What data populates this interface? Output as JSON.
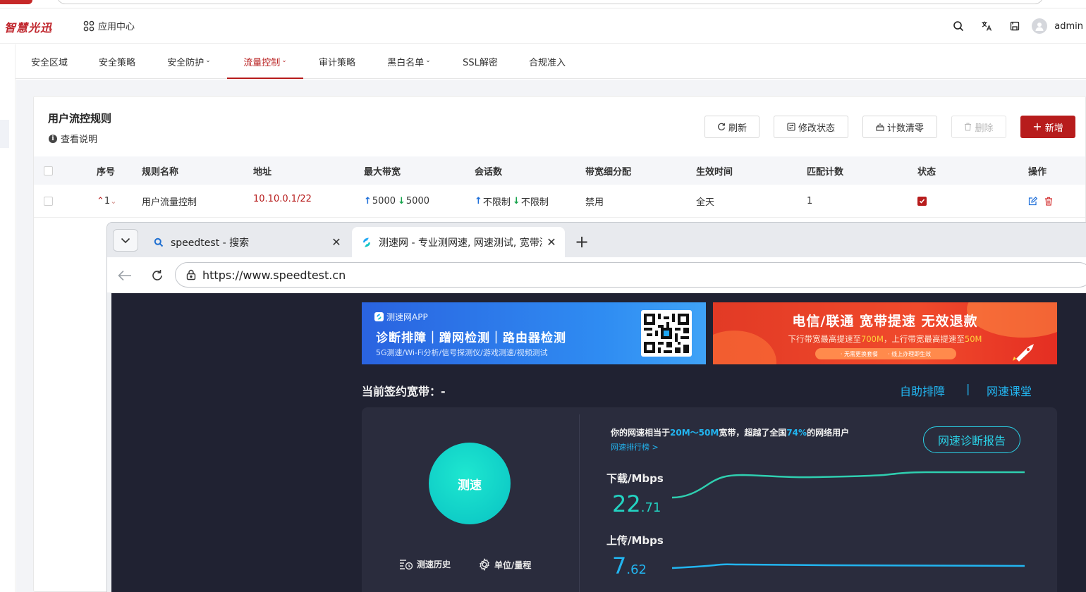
{
  "header": {
    "logo_text": "智慧光迅",
    "app_center_label": "应用中心",
    "user_name": "admin"
  },
  "nav": {
    "tabs": [
      {
        "label": "安全区域",
        "has_caret": false
      },
      {
        "label": "安全策略",
        "has_caret": false
      },
      {
        "label": "安全防护",
        "has_caret": true
      },
      {
        "label": "流量控制",
        "has_caret": true,
        "active": true
      },
      {
        "label": "审计策略",
        "has_caret": false
      },
      {
        "label": "黑白名单",
        "has_caret": true
      },
      {
        "label": "SSL解密",
        "has_caret": false
      },
      {
        "label": "合规准入",
        "has_caret": false
      }
    ]
  },
  "card": {
    "title": "用户流控规则",
    "help_label": "查看说明",
    "buttons": {
      "refresh": "刷新",
      "modify_status": "修改状态",
      "clear_count": "计数清零",
      "delete": "删除",
      "add": "新增"
    }
  },
  "table": {
    "headers": {
      "seq": "序号",
      "name": "规则名称",
      "address": "地址",
      "max_bw": "最大带宽",
      "sessions": "会话数",
      "bw_alloc": "带宽细分配",
      "time": "生效时间",
      "match": "匹配计数",
      "status": "状态",
      "ops": "操作"
    },
    "rows": [
      {
        "seq": "1",
        "name": "用户流量控制",
        "address": "10.10.0.1/22",
        "bw_up": "5000",
        "bw_down": "5000",
        "sess_up": "不限制",
        "sess_down": "不限制",
        "bw_alloc": "禁用",
        "time": "全天",
        "match": "1",
        "enabled": true
      }
    ]
  },
  "browser": {
    "tabs": [
      {
        "title": "speedtest - 搜索",
        "icon": "search-icon"
      },
      {
        "title": "测速网 - 专业测网速, 网速测试, 宽带测速",
        "icon": "speedtest-favicon",
        "active": true
      }
    ],
    "url": "https://www.speedtest.cn"
  },
  "speedtest": {
    "ad_left": {
      "app_name": "测速网APP",
      "headline": "诊断排障｜蹭网检测｜路由器检测",
      "subline": "5G测速/Wi-Fi分析/信号探测仪/游戏测速/视频测试"
    },
    "ad_right": {
      "headline": "电信/联通 宽带提速 无效退款",
      "sub_prefix": "下行带宽最高提速至",
      "sub_down": "700M",
      "sub_mid": "，上行带宽最高提速至",
      "sub_up": "50M",
      "tag1": "· 无需更换套餐",
      "tag2": "· 线上办理即生效"
    },
    "contract_label": "当前签约宽带：-",
    "self_help_link": "自助排障",
    "separator": "|",
    "class_link": "网速课堂",
    "start_button": "测速",
    "history_link": "测速历史",
    "unit_link": "单位/量程",
    "summary_prefix": "你的网速相当于",
    "summary_range": "20M～50M",
    "summary_mid": "宽带，超越了全国",
    "summary_percent": "74%",
    "summary_suffix": "的网络用户",
    "rank_link": "网速排行榜 >",
    "report_button": "网速诊断报告",
    "download": {
      "label": "下载/Mbps",
      "int": "22",
      "dec": ".71"
    },
    "upload": {
      "label": "上传/Mbps",
      "int": "7",
      "dec": ".62"
    },
    "colors": {
      "download_line": "#2fcfb0",
      "upload_line": "#22b5f0"
    }
  }
}
